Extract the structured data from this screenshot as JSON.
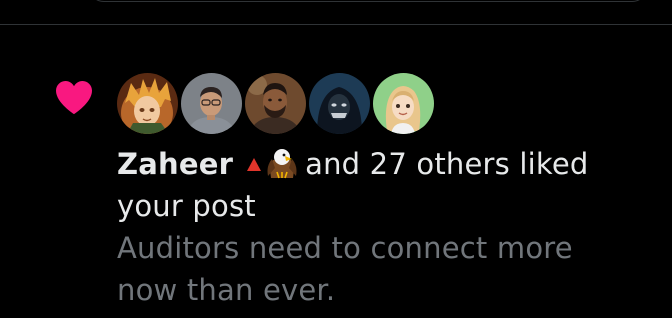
{
  "notification": {
    "type_icon": "heart-icon",
    "heart_color": "#f91880",
    "avatars": [
      {
        "name": "avatar-anime-character",
        "icon": "anime-character-avatar"
      },
      {
        "name": "avatar-man-glasses",
        "icon": "man-avatar"
      },
      {
        "name": "avatar-man-beard",
        "icon": "man-avatar"
      },
      {
        "name": "avatar-hooded-figure",
        "icon": "hooded-figure-avatar"
      },
      {
        "name": "avatar-cartoon-blonde",
        "icon": "cartoon-avatar"
      }
    ],
    "username": "Zaheer",
    "badges": [
      "red-triangle-icon",
      "eagle-icon"
    ],
    "liked_suffix": "and 27 others liked your post",
    "post_preview": "Auditors need to connect more now than ever."
  },
  "colors": {
    "background": "#000000",
    "primary_text": "#e7e9ea",
    "secondary_text": "#71767b",
    "divider": "#2f3336"
  }
}
